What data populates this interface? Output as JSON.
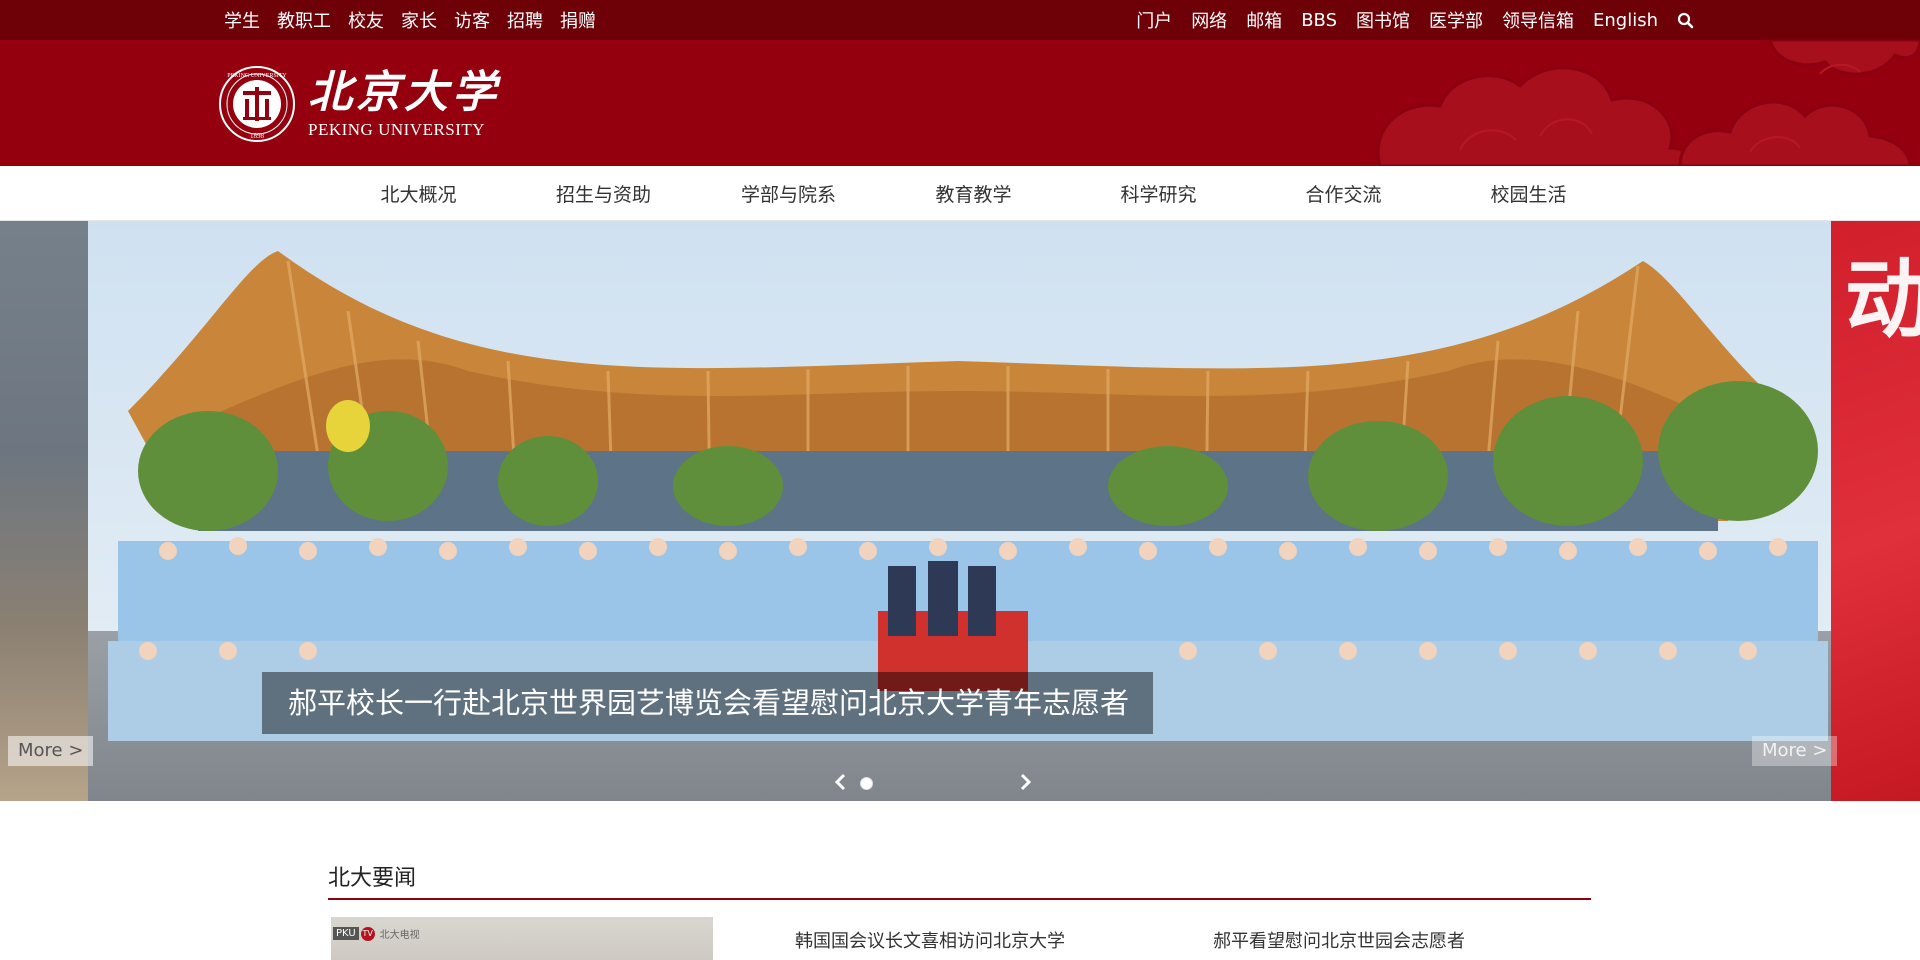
{
  "topbar": {
    "left_links": [
      "学生",
      "教职工",
      "校友",
      "家长",
      "访客",
      "招聘",
      "捐赠"
    ],
    "right_links": [
      "门户",
      "网络",
      "邮箱",
      "BBS",
      "图书馆",
      "医学部",
      "领导信箱",
      "English"
    ],
    "search_icon": "search-icon"
  },
  "header": {
    "logo_cn": "北京大学",
    "logo_en": "PEKING UNIVERSITY",
    "seal_text_top": "PEKING UNIVERSITY",
    "seal_year": "1898",
    "colors": {
      "topbar_bg": "#6e0008",
      "header_bg": "#94000e"
    }
  },
  "mainnav": {
    "items": [
      "北大概况",
      "招生与资助",
      "学部与院系",
      "教育教学",
      "科学研究",
      "合作交流",
      "校园生活"
    ]
  },
  "banner": {
    "caption": "郝平校长一行赴北京世界园艺博览会看望慰问北京大学青年志愿者",
    "more_left": "More >",
    "more_right": "More >",
    "next_slide_glyph": "动"
  },
  "news": {
    "section_title": "北大要闻",
    "thumb_badge_pku": "PKU",
    "thumb_badge_tv": "TV",
    "thumb_badge_name": "北大电视",
    "items": [
      "韩国国会议长文喜相访问北京大学",
      "郝平看望慰问北京世园会志愿者"
    ]
  }
}
